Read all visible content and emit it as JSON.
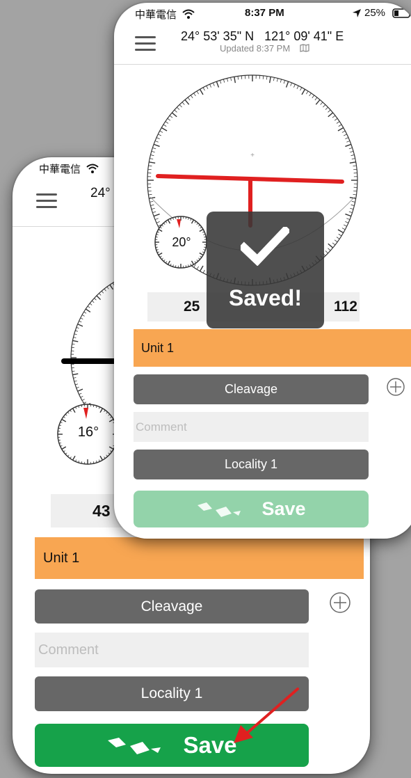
{
  "back_screen": {
    "status": {
      "carrier": "中華電信"
    },
    "header": {
      "coordinates": "24°"
    },
    "inclinometer": {
      "dip_label": "16°"
    },
    "readout": {
      "value": "43"
    },
    "form": {
      "unit": "Unit 1",
      "type_button": "Cleavage",
      "comment_placeholder": "Comment",
      "locality_button": "Locality 1",
      "save_label": "Save"
    },
    "colors": {
      "save": "#16a24a",
      "unit": "#f8a652"
    }
  },
  "front_screen": {
    "status": {
      "carrier": "中華電信",
      "time": "8:37 PM",
      "battery": "25%"
    },
    "header": {
      "coordinates": "24° 53' 35\" N   121° 09' 41\" E",
      "updated": "Updated 8:37 PM"
    },
    "inclinometer": {
      "dip_label": "20°"
    },
    "readout": {
      "left": "25",
      "right": "112"
    },
    "toast": {
      "message": "Saved!"
    },
    "form": {
      "unit": "Unit 1",
      "type_button": "Cleavage",
      "comment_placeholder": "Comment",
      "locality_button": "Locality 1",
      "save_label": "Save"
    },
    "colors": {
      "save": "#93d3aa",
      "unit": "#f8a652",
      "strike_line": "#e02020"
    }
  },
  "icons": [
    "wifi-icon",
    "hamburger-menu-icon",
    "map-icon",
    "location-arrow-icon",
    "battery-icon",
    "add-circle-icon",
    "checkmark-icon",
    "save-logo-icon",
    "red-arrow-annotation"
  ]
}
